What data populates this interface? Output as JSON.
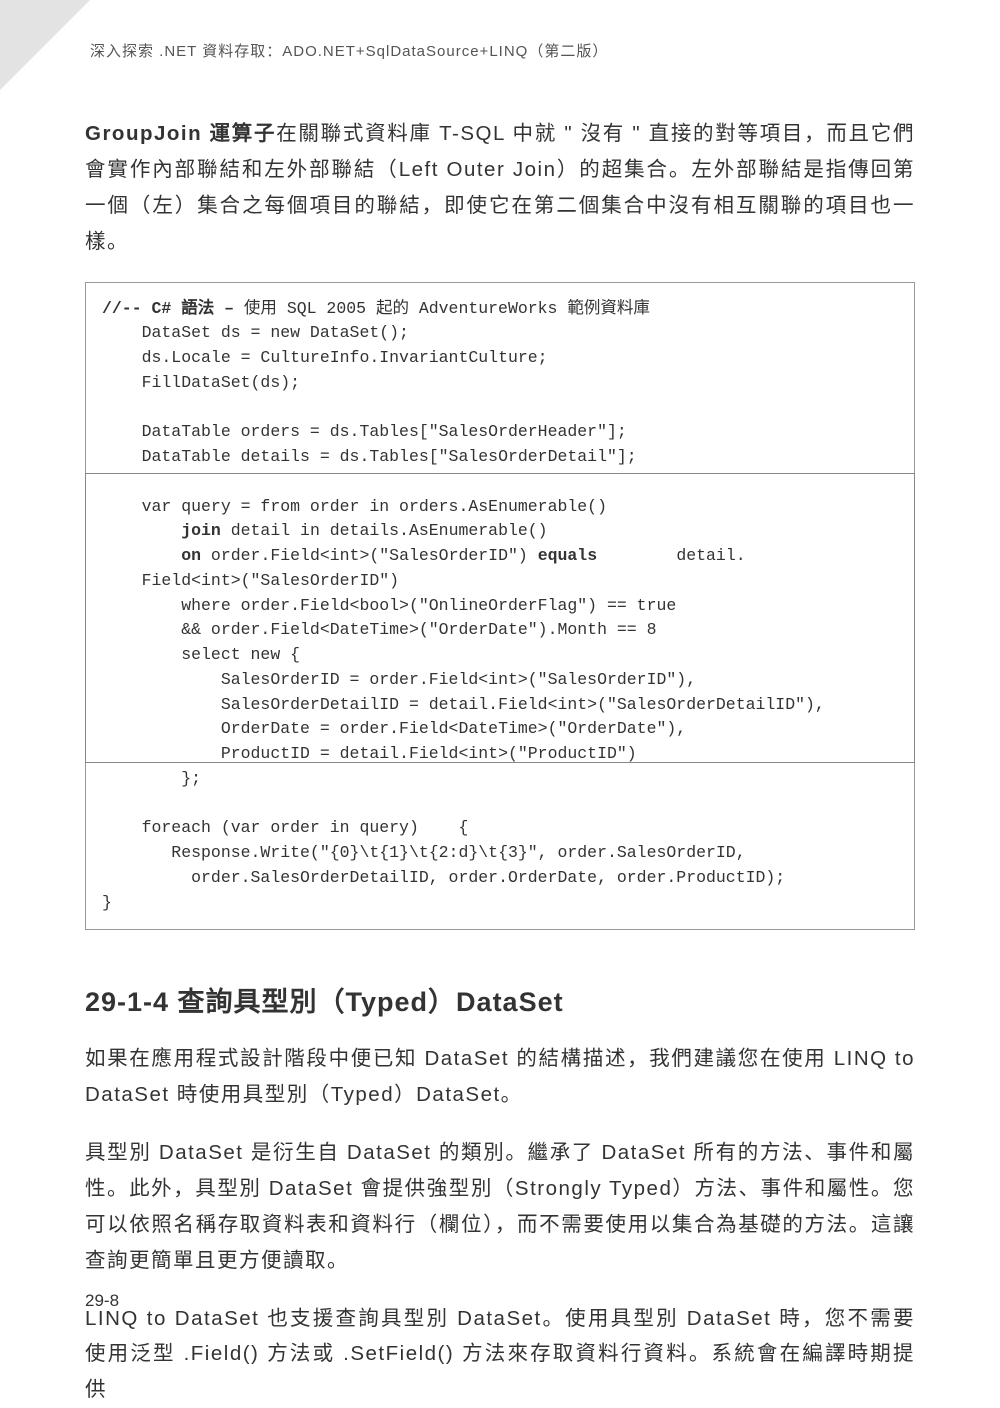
{
  "header": {
    "running_title": "深入探索 .NET 資料存取：ADO.NET+SqlDataSource+LINQ（第二版）"
  },
  "para1": {
    "strong": "GroupJoin 運算子",
    "rest": "在關聯式資料庫 T-SQL 中就 \" 沒有 \" 直接的對等項目，而且它們會實作內部聯結和左外部聯結（Left Outer Join）的超集合。左外部聯結是指傳回第一個（左）集合之每個項目的聯結，即使它在第二個集合中沒有相互關聯的項目也一樣。"
  },
  "code": {
    "l1_a": "//-- C# 語法 – ",
    "l1_b": "使用 SQL 2005 起的 AdventureWorks 範例資料庫",
    "l2": "    DataSet ds = new DataSet();",
    "l3": "    ds.Locale = CultureInfo.InvariantCulture;",
    "l4": "    FillDataSet(ds);",
    "l5": "",
    "l6": "    DataTable orders = ds.Tables[\"SalesOrderHeader\"];",
    "l7": "    DataTable details = ds.Tables[\"SalesOrderDetail\"];",
    "l8": "",
    "l9": "    var query = from order in orders.AsEnumerable()",
    "l10_a": "        ",
    "l10_b": "join",
    "l10_c": " detail in details.AsEnumerable()",
    "l11_a": "        ",
    "l11_b": "on",
    "l11_c": " order.Field<int>(\"SalesOrderID\") ",
    "l11_d": "equals",
    "l11_e": "        detail.",
    "l12": "    Field<int>(\"SalesOrderID\")",
    "l13": "        where order.Field<bool>(\"OnlineOrderFlag\") == true",
    "l14": "        && order.Field<DateTime>(\"OrderDate\").Month == 8",
    "l15": "        select new {",
    "l16": "            SalesOrderID = order.Field<int>(\"SalesOrderID\"),",
    "l17": "            SalesOrderDetailID = detail.Field<int>(\"SalesOrderDetailID\"),",
    "l18": "            OrderDate = order.Field<DateTime>(\"OrderDate\"),",
    "l19": "            ProductID = detail.Field<int>(\"ProductID\")",
    "l20": "        };",
    "l21": "",
    "l22": "    foreach (var order in query)    {",
    "l23": "       Response.Write(\"{0}\\t{1}\\t{2:d}\\t{3}\", order.SalesOrderID,",
    "l24": "         order.SalesOrderDetailID, order.OrderDate, order.ProductID);",
    "l25": "}"
  },
  "section": {
    "heading": "29-1-4  查詢具型別（Typed）DataSet"
  },
  "para2": "如果在應用程式設計階段中便已知 DataSet 的結構描述，我們建議您在使用 LINQ to DataSet 時使用具型別（Typed）DataSet。",
  "para3": "具型別 DataSet 是衍生自 DataSet 的類別。繼承了 DataSet 所有的方法、事件和屬性。此外，具型別 DataSet 會提供強型別（Strongly Typed）方法、事件和屬性。您可以依照名稱存取資料表和資料行（欄位），而不需要使用以集合為基礎的方法。這讓查詢更簡單且更方便讀取。",
  "para4": "LINQ to DataSet 也支援查詢具型別 DataSet。使用具型別 DataSet 時，您不需要使用泛型 .Field() 方法或 .SetField() 方法來存取資料行資料。系統會在編譯時期提供",
  "footer": {
    "page_number": "29-8"
  }
}
